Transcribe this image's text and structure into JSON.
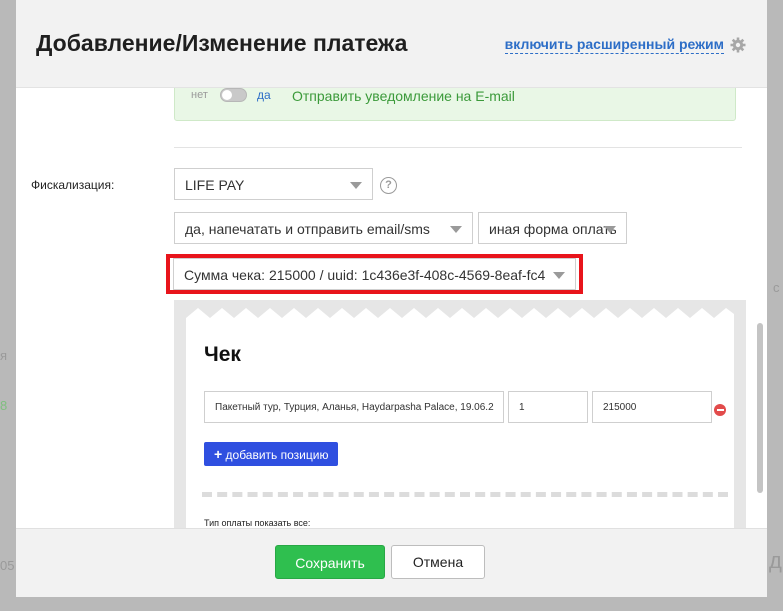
{
  "header": {
    "title": "Добавление/Изменение платежа",
    "advanced_link": "включить расширенный режим"
  },
  "notification": {
    "no_label": "нет",
    "yes_label": "да",
    "email_text": "Отправить уведомление на E-mail",
    "toggle_on": false
  },
  "fiscalization": {
    "label": "Фискализация:",
    "provider": "LIFE PAY",
    "print_option": "да, напечатать и отправить email/sms",
    "payment_form": "иная форма оплаты",
    "receipt_select": "Сумма чека: 215000 / uuid: 1c436e3f-408c-4569-8eaf-fc4"
  },
  "receipt": {
    "title": "Чек",
    "items": [
      {
        "name": "Пакетный тур, Турция, Аланья, Haydarpasha Palace, 19.06.2",
        "quantity": "1",
        "price": "215000"
      }
    ],
    "add_position": "добавить позицию",
    "payment_type_label": "Тип оплаты",
    "show_all": "показать все:"
  },
  "footer": {
    "save": "Сохранить",
    "cancel": "Отмена"
  },
  "colors": {
    "accent": "#2d6ec7",
    "save": "#2fbf4f",
    "highlight": "#e8141b",
    "notice_bg": "#e9f7e6"
  }
}
